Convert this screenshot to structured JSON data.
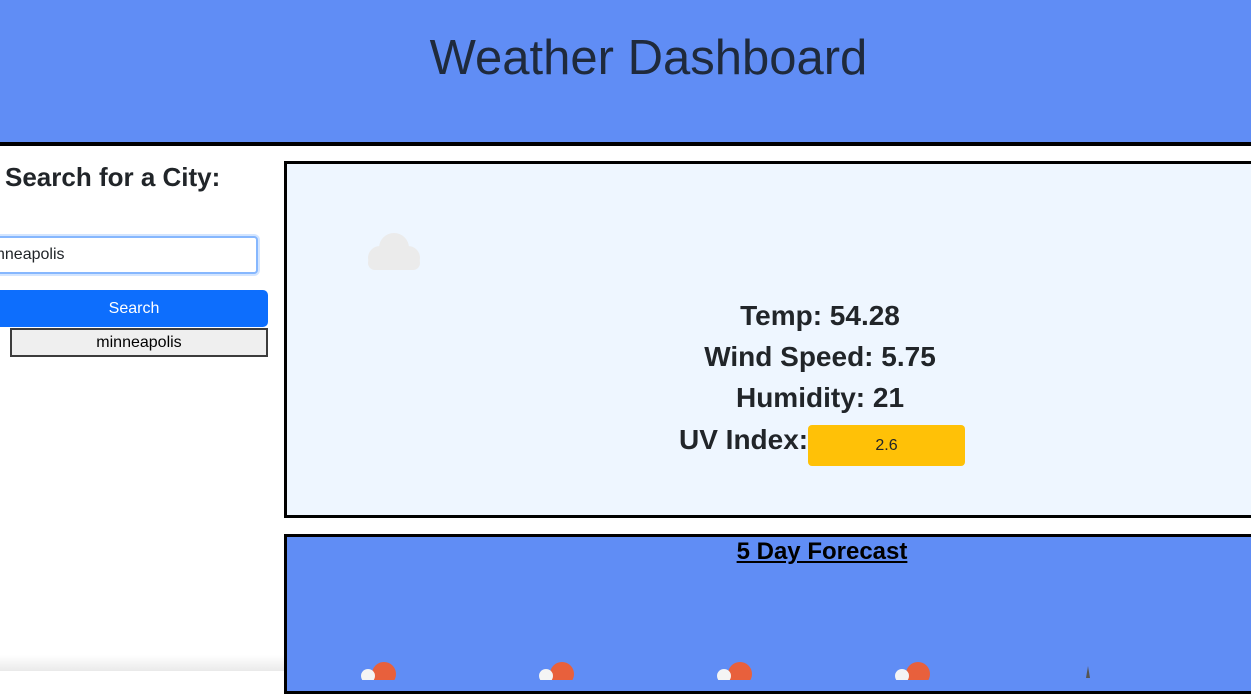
{
  "header": {
    "title": "Weather Dashboard"
  },
  "sidebar": {
    "title": "Search for a City:",
    "search_value": "nneapolis",
    "search_button_label": "Search",
    "history": [
      "minneapolis"
    ]
  },
  "current": {
    "icon": "cloud-icon",
    "temp": "Temp: 54.28",
    "wind": "Wind Speed: 5.75",
    "humidity": "Humidity: 21",
    "uv_label": "UV Index:",
    "uv_value": "2.6",
    "uv_color": "#ffc107"
  },
  "forecast": {
    "title": "5 Day Forecast",
    "icons": [
      "partly-cloudy-icon",
      "partly-cloudy-icon",
      "partly-cloudy-icon",
      "partly-cloudy-icon",
      "rain-icon"
    ]
  },
  "colors": {
    "header_bg": "#608df5",
    "current_bg": "#eef6ff",
    "primary_button": "#0d6efd"
  }
}
